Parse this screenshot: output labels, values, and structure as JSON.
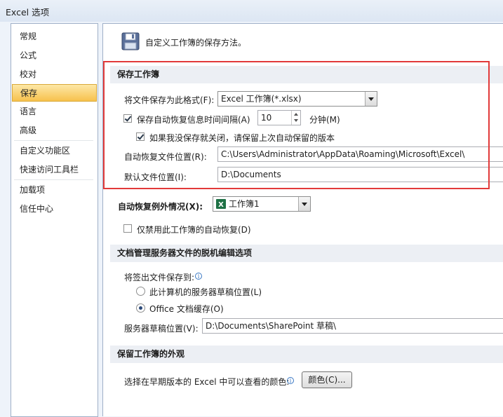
{
  "window": {
    "title": "Excel 选项"
  },
  "sidebar": {
    "items": [
      {
        "label": "常规"
      },
      {
        "label": "公式"
      },
      {
        "label": "校对"
      },
      {
        "label": "保存"
      },
      {
        "label": "语言"
      },
      {
        "label": "高级"
      },
      {
        "label": "自定义功能区"
      },
      {
        "label": "快速访问工具栏"
      },
      {
        "label": "加载项"
      },
      {
        "label": "信任中心"
      }
    ],
    "active_item": "保存"
  },
  "main": {
    "intro_text": "自定义工作簿的保存方法。",
    "save_workbooks": {
      "header": "保存工作簿",
      "format_label": "将文件保存为此格式(F):",
      "format_value": "Excel 工作簿(*.xlsx)",
      "autorecover_label": "保存自动恢复信息时间间隔(A)",
      "autorecover_checked": true,
      "autorecover_minutes": "10",
      "minutes_label": "分钟(M)",
      "keep_last_label": "如果我没保存就关闭，请保留上次自动保留的版本",
      "keep_last_checked": true,
      "autorecover_location_label": "自动恢复文件位置(R):",
      "autorecover_location_value": "C:\\Users\\Administrator\\AppData\\Roaming\\Microsoft\\Excel\\",
      "default_location_label": "默认文件位置(I):",
      "default_location_value": "D:\\Documents"
    },
    "autorecover_exceptions": {
      "label": "自动恢复例外情况(X):",
      "workbook_value": "工作簿1",
      "disable_label": "仅禁用此工作簿的自动恢复(D)",
      "disable_checked": false
    },
    "offline_editing": {
      "header": "文档管理服务器文件的脱机编辑选项",
      "save_to_label": "将签出文件保存到:",
      "option_server_drafts": "此计算机的服务器草稿位置(L)",
      "option_office_cache": "Office 文档缓存(O)",
      "selected_option": "Office 文档缓存(O)",
      "drafts_location_label": "服务器草稿位置(V):",
      "drafts_location_value": "D:\\Documents\\SharePoint 草稿\\"
    },
    "preserve_visual": {
      "header": "保留工作簿的外观",
      "colors_label": "选择在早期版本的 Excel 中可以查看的颜色:",
      "colors_button": "颜色(C)..."
    }
  },
  "colors": {
    "highlight_box": "#e23a3a",
    "active_nav": "#f7c14d",
    "section_header_bg": "#eceff4",
    "excel_green": "#1e7145"
  },
  "icons": [
    "save-disk-icon",
    "info-icon",
    "excel-workbook-icon",
    "dropdown-arrow-icon"
  ]
}
